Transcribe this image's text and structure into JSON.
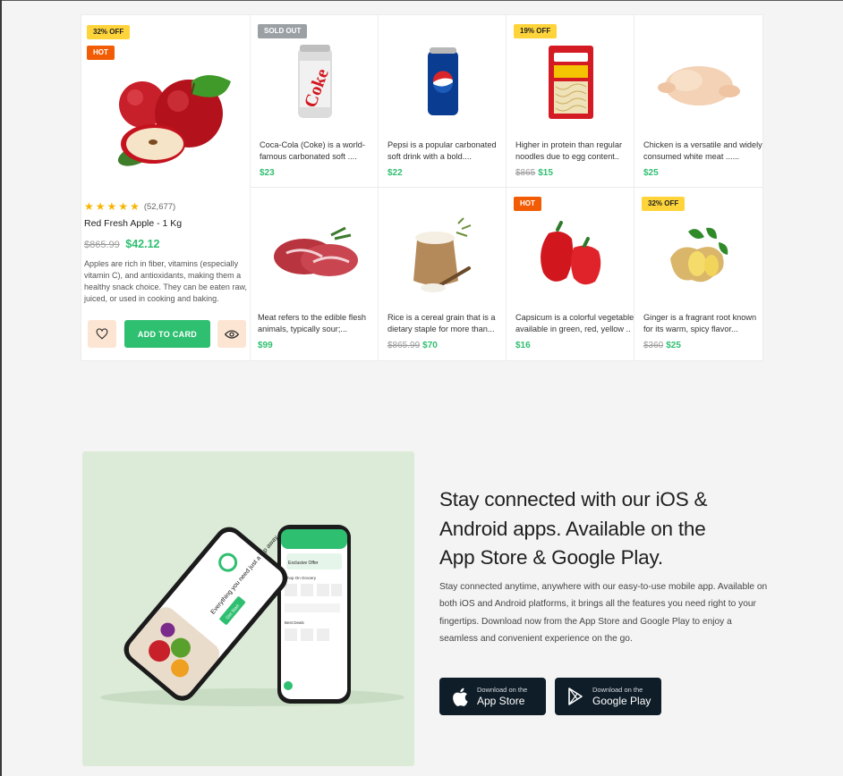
{
  "featured": {
    "badges": [
      "32% OFF",
      "HOT"
    ],
    "rating_count": "(52,677)",
    "title": "Red Fresh Apple - 1 Kg",
    "old_price": "$865.99",
    "price": "$42.12",
    "description": "Apples are rich in fiber, vitamins (especially vitamin C), and antioxidants, making them a healthy snack choice. They can be eaten raw, juiced, or used in cooking and baking.",
    "add_button": "ADD TO CARD",
    "wishlist_icon": "heart-icon",
    "view_icon": "eye-icon"
  },
  "products": [
    {
      "badge": "SOLD OUT",
      "line1": "Coca-Cola (Coke) is a world-",
      "line2": "famous carbonated soft ....",
      "old_price": "",
      "price": "$23",
      "icon": "coke-can"
    },
    {
      "badge": "",
      "line1": "Pepsi is a popular carbonated",
      "line2": "soft drink with a bold....",
      "old_price": "",
      "price": "$22",
      "icon": "pepsi-can"
    },
    {
      "badge": "19% OFF",
      "line1": "Higher in protein than regular",
      "line2": "noodles due to egg content..",
      "old_price": "$865",
      "price": "$15",
      "icon": "egg-noodles-pack"
    },
    {
      "badge": "",
      "line1": "Chicken is a versatile and widely",
      "line2": "consumed white meat ......",
      "old_price": "",
      "price": "$25",
      "icon": "raw-chicken"
    },
    {
      "badge": "",
      "line1": "Meat refers to the edible flesh",
      "line2": "animals, typically sour;...",
      "old_price": "",
      "price": "$99",
      "icon": "raw-meat"
    },
    {
      "badge": "",
      "line1": "Rice is a cereal grain that is a",
      "line2": "dietary staple for more than...",
      "old_price": "$865.99",
      "price": "$70",
      "icon": "rice-sack"
    },
    {
      "badge": "HOT",
      "line1": "Capsicum is a colorful vegetable",
      "line2": "available in green, red, yellow ..",
      "old_price": "",
      "price": "$16",
      "icon": "red-capsicum"
    },
    {
      "badge": "32% OFF",
      "line1": "Ginger is a fragrant root known",
      "line2": "for its warm, spicy flavor...",
      "old_price": "$360",
      "price": "$25",
      "icon": "ginger-root"
    }
  ],
  "app_section": {
    "heading_line1": "Stay connected with our iOS &",
    "heading_line2": "Android apps. Available on the",
    "heading_line3": "App Store & Google Play.",
    "body": "Stay connected anytime, anywhere with our easy-to-use mobile app. Available on both iOS and Android platforms, it brings all the features you need right to your fingertips. Download now from the App Store and Google Play to enjoy a seamless and convenient experience on the go.",
    "app_store_small": "Download on the",
    "app_store_big": "App Store",
    "google_play_small": "Download on the",
    "google_play_big": "Google Play",
    "phone_left_text": "Everything you need just a tap away",
    "phone_left_button": "Get Start",
    "phone_right_banner": "Exclusive Offer",
    "phone_right_section1": "Shop On Grocery",
    "phone_right_section2": "Best Deals"
  },
  "colors": {
    "accent": "#2fbf71",
    "hot": "#f25c05",
    "discount": "#ffd43b",
    "store_button": "#0f1d28",
    "promo_bg": "#dcebd8"
  }
}
